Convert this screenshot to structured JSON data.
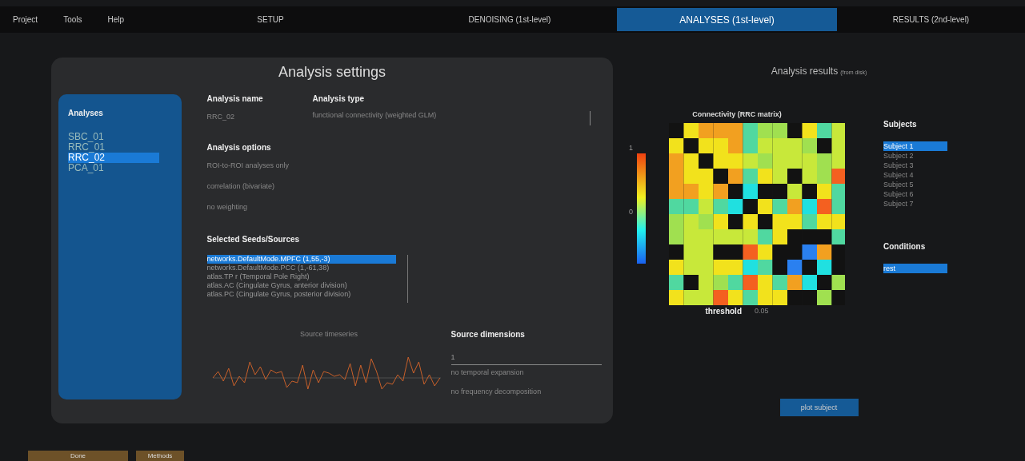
{
  "menu": [
    "Project",
    "Tools",
    "Help"
  ],
  "tabs": [
    {
      "label": "SETUP",
      "selected": false
    },
    {
      "label": "DENOISING (1st-level)",
      "selected": false
    },
    {
      "label": "ANALYSES (1st-level)",
      "selected": true
    },
    {
      "label": "RESULTS (2nd-level)",
      "selected": false
    }
  ],
  "settings": {
    "title": "Analysis settings",
    "analyses": {
      "heading": "Analyses",
      "items": [
        {
          "label": "SBC_01",
          "selected": false
        },
        {
          "label": "RRC_01",
          "selected": false
        },
        {
          "label": "RRC_02",
          "selected": true
        },
        {
          "label": "PCA_01",
          "selected": false
        }
      ]
    },
    "name": {
      "heading": "Analysis name",
      "value": "RRC_02"
    },
    "type": {
      "heading": "Analysis type",
      "value": "functional connectivity (weighted GLM)"
    },
    "options": {
      "heading": "Analysis options",
      "items": [
        "ROI-to-ROI analyses only",
        "correlation (bivariate)",
        "no weighting"
      ]
    },
    "sources": {
      "heading": "Selected Seeds/Sources",
      "items": [
        {
          "label": "networks.DefaultMode.MPFC (1,55,-3)",
          "selected": true
        },
        {
          "label": "networks.DefaultMode.PCC (1,-61,38)",
          "selected": false
        },
        {
          "label": "atlas.TP r (Temporal Pole Right)",
          "selected": false
        },
        {
          "label": "atlas.AC (Cingulate Gyrus, anterior division)",
          "selected": false
        },
        {
          "label": "atlas.PC (Cingulate Gyrus, posterior division)",
          "selected": false
        }
      ]
    },
    "timeseries": {
      "title": "Source timeseries"
    },
    "dimensions": {
      "heading": "Source dimensions",
      "value": "1",
      "items": [
        "no temporal expansion",
        "no frequency decomposition"
      ]
    }
  },
  "results": {
    "title": "Analysis results",
    "note": "(from disk)",
    "matrix_title": "Connectivity (RRC matrix)",
    "colorbar_ticks": [
      "1",
      "0"
    ],
    "threshold_label": "threshold",
    "threshold": "0.05",
    "subjects": {
      "heading": "Subjects",
      "items": [
        {
          "label": "Subject  1",
          "selected": true
        },
        {
          "label": "Subject  2",
          "selected": false
        },
        {
          "label": "Subject  3",
          "selected": false
        },
        {
          "label": "Subject  4",
          "selected": false
        },
        {
          "label": "Subject  5",
          "selected": false
        },
        {
          "label": "Subject  6",
          "selected": false
        },
        {
          "label": "Subject  7",
          "selected": false
        }
      ]
    },
    "conditions": {
      "heading": "Conditions",
      "items": [
        {
          "label": "rest",
          "selected": true
        }
      ]
    },
    "plot_button": "plot subject"
  },
  "footer": {
    "buttons": [
      "Done",
      "Methods"
    ]
  }
}
